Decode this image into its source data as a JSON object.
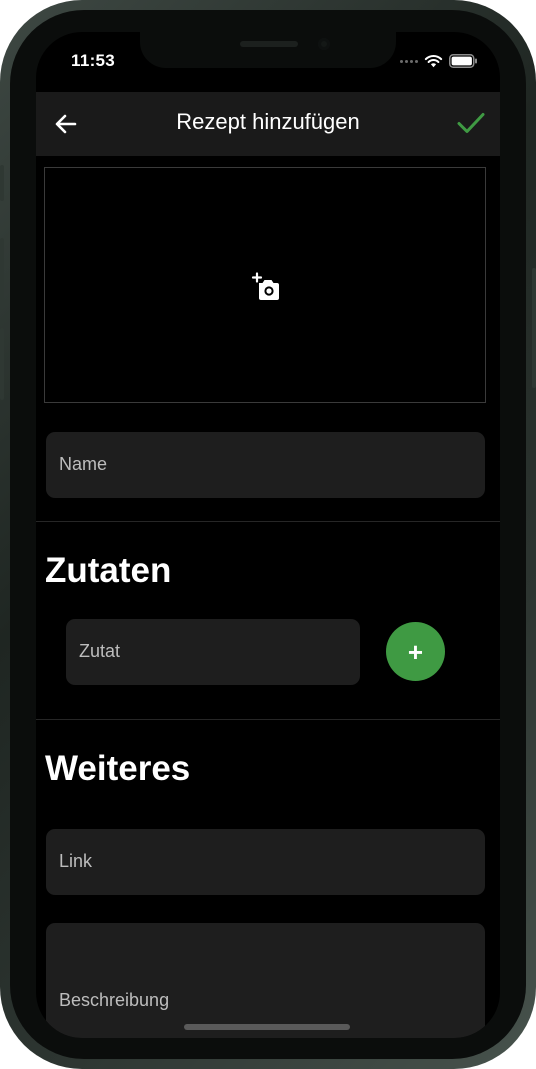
{
  "status_bar": {
    "time": "11:53"
  },
  "app_bar": {
    "title": "Rezept hinzufügen",
    "back_icon": "arrow-left-icon",
    "confirm_icon": "check-icon",
    "accent_color": "#3f9a43"
  },
  "image_picker": {
    "icon": "add-photo-icon"
  },
  "form": {
    "name_placeholder": "Name",
    "ingredients_title": "Zutaten",
    "ingredient_placeholder": "Zutat",
    "add_ingredient_label": "+",
    "more_title": "Weiteres",
    "link_placeholder": "Link",
    "description_placeholder": "Beschreibung"
  }
}
